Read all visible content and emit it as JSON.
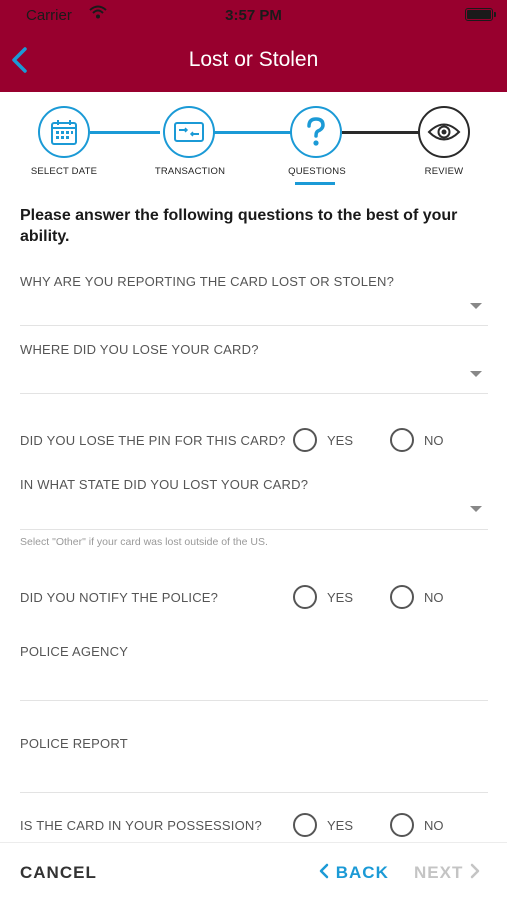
{
  "status": {
    "carrier": "Carrier",
    "time": "3:57 PM"
  },
  "nav": {
    "title": "Lost or Stolen"
  },
  "steps": [
    {
      "label": "SELECT DATE",
      "icon": "calendar-icon"
    },
    {
      "label": "TRANSACTION",
      "icon": "card-transfer-icon"
    },
    {
      "label": "QUESTIONS",
      "icon": "question-icon",
      "active": true
    },
    {
      "label": "REVIEW",
      "icon": "eye-icon"
    }
  ],
  "form": {
    "intro": "Please answer the following questions to the best of your ability.",
    "reason_label": "WHY ARE YOU REPORTING THE CARD LOST OR STOLEN?",
    "where_label": "WHERE DID YOU LOSE YOUR CARD?",
    "pin_label": "DID YOU LOSE THE PIN FOR THIS CARD?",
    "state_label": "IN WHAT STATE DID YOU LOST YOUR CARD?",
    "state_hint": "Select \"Other\" if your card was lost outside of the US.",
    "police_label": "DID YOU NOTIFY THE POLICE?",
    "agency_label": "POLICE AGENCY",
    "report_label": "POLICE REPORT",
    "possession_label": "IS THE CARD IN YOUR POSSESSION?",
    "yes": "YES",
    "no": "NO"
  },
  "footer": {
    "cancel": "CANCEL",
    "back": "BACK",
    "next": "NEXT"
  },
  "colors": {
    "brand": "#98002e",
    "accent": "#1b9ad6",
    "disabled": "#c4c4c4"
  }
}
